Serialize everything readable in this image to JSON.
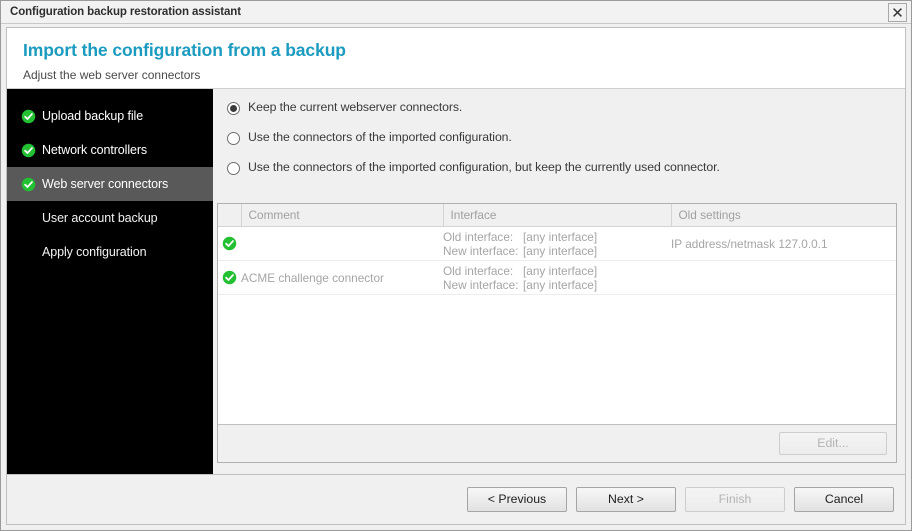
{
  "window": {
    "title": "Configuration backup restoration assistant",
    "close_icon": "close-icon"
  },
  "header": {
    "title": "Import the configuration from a backup",
    "subtitle": "Adjust the web server connectors",
    "accent_color": "#1a9bbf"
  },
  "sidebar": {
    "background_color": "#000000",
    "active_background_color": "#595959",
    "check_color": "#22c032",
    "items": [
      {
        "label": "Upload backup file",
        "completed": true,
        "active": false
      },
      {
        "label": "Network controllers",
        "completed": true,
        "active": false
      },
      {
        "label": "Web server connectors",
        "completed": true,
        "active": true
      },
      {
        "label": "User account backup",
        "completed": false,
        "active": false
      },
      {
        "label": "Apply configuration",
        "completed": false,
        "active": false
      }
    ]
  },
  "options": {
    "items": [
      {
        "label": "Keep the current webserver connectors.",
        "selected": true
      },
      {
        "label": "Use the connectors of the imported configuration.",
        "selected": false
      },
      {
        "label": "Use the connectors of the imported configuration, but keep the currently used connector.",
        "selected": false
      }
    ]
  },
  "table": {
    "columns": [
      "",
      "Comment",
      "Interface",
      "Old settings"
    ],
    "rows": [
      {
        "state": "ok",
        "comment": "",
        "old_interface_label": "Old interface:",
        "old_interface_value": "[any interface]",
        "new_interface_label": "New interface:",
        "new_interface_value": "[any interface]",
        "old_settings": "IP address/netmask 127.0.0.1"
      },
      {
        "state": "ok",
        "comment": "ACME challenge connector",
        "old_interface_label": "Old interface:",
        "old_interface_value": "[any interface]",
        "new_interface_label": "New interface:",
        "new_interface_value": "[any interface]",
        "old_settings": ""
      }
    ],
    "edit_button": {
      "label": "Edit...",
      "enabled": false
    }
  },
  "footer": {
    "previous_button": {
      "label": "< Previous",
      "enabled": true
    },
    "next_button": {
      "label": "Next >",
      "enabled": true
    },
    "finish_button": {
      "label": "Finish",
      "enabled": false
    },
    "cancel_button": {
      "label": "Cancel",
      "enabled": true
    }
  }
}
